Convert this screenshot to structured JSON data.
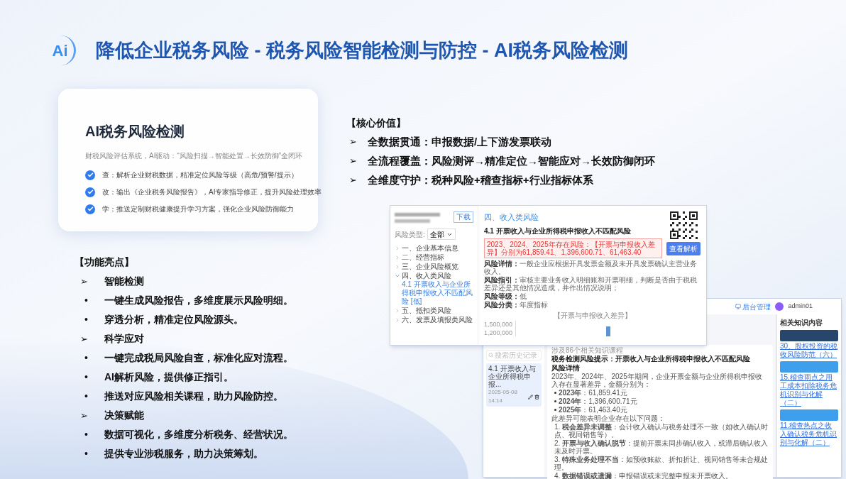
{
  "header": {
    "logo": "Ai",
    "title": "降低企业税务风险 - 税务风险智能检测与防控 - AI税务风险检测"
  },
  "card": {
    "title": "AI税务风险检测",
    "subtitle": "财税风险评估系统，AI驱动：“风险扫描→智能处置→长效防御”全闭环",
    "items": [
      {
        "text": "查：解析企业财税数据，精准定位风险等级（高危/预警/提示）",
        "checked": true
      },
      {
        "text": "改：输出《企业税务风险报告》，AI专家指导修正，提升风险处理效率",
        "checked": true
      },
      {
        "text": "学：推送定制财税健康提升学习方案，强化企业风险防御能力",
        "checked": true
      }
    ]
  },
  "highlights": {
    "heading": "【功能亮点】",
    "groups": [
      {
        "marker": "➢",
        "title": "智能检测",
        "items": [
          {
            "bullet": "•",
            "text": "一键生成风险报告，多维度展示风险明细。"
          },
          {
            "bullet": "•",
            "text": "穿透分析，精准定位风险源头。"
          }
        ]
      },
      {
        "marker": "➢",
        "title": "科学应对",
        "items": [
          {
            "bullet": "•",
            "text": "一键完成税局风险自查，标准化应对流程。"
          },
          {
            "bullet": "•",
            "text": "AI解析风险，提供修正指引。"
          },
          {
            "bullet": "•",
            "text": "推送对应风险相关课程，助力风险防控。"
          }
        ]
      },
      {
        "marker": "➢",
        "title": "决策赋能",
        "items": [
          {
            "bullet": "•",
            "text": "数据可视化，多维度分析税务、经营状况。"
          },
          {
            "bullet": "•",
            "text": "提供专业涉税服务，助力决策筹划。"
          }
        ]
      }
    ]
  },
  "core_value": {
    "heading": "【核心价值】",
    "items": [
      {
        "marker": "➢",
        "text": "全数据贯通：申报数据/上下游发票联动"
      },
      {
        "marker": "➢",
        "text": "全流程覆盖：风险测评→精准定位→智能应对→长效防御闭环"
      },
      {
        "marker": "➢",
        "text": "全维度守护：税种风险+稽查指标+行业指标体系"
      }
    ]
  },
  "report_window": {
    "download_button": "下载",
    "filter": {
      "label": "风险类型:",
      "value": "全部"
    },
    "tree": [
      {
        "label": "一、企业基本信息",
        "expanded": false
      },
      {
        "label": "二、经营指标",
        "expanded": false
      },
      {
        "label": "三、企业风险概览",
        "expanded": false
      },
      {
        "label": "四、收入类风险",
        "expanded": true,
        "children": [
          {
            "label": "4.1 开票收入与企业所得税申报收入不匹配风险 [低]",
            "selected": true
          }
        ]
      },
      {
        "label": "五、抵扣类风险",
        "expanded": false
      },
      {
        "label": "六、发票及填报类风险",
        "expanded": false
      }
    ],
    "section_title": "四、收入类风险",
    "risk_title": "4.1 开票收入与企业所得税申报收入不匹配风险",
    "alert": "2023、2024、2025年存在风险：【开票与申报收入差异】分别为61,859.41、1,396,600.71、61,463.40",
    "fields": [
      {
        "label": "风险详情：",
        "value": "一般企业应根据开具发票金额及未开具发票确认主营业务收入。"
      },
      {
        "label": "风险指引：",
        "value": "审核主要业务收入明细账和开票明细，判断是否由于税税差异还是其他情况造成，并作出情况说明；"
      },
      {
        "label": "风险等级：",
        "value": "低"
      },
      {
        "label": "风险分类：",
        "value": "年度指标"
      }
    ],
    "analysis_button": "查看解析",
    "chart": {
      "legend": "【开票与申报收入差异】",
      "ticks": [
        "1,500,000",
        "1,200,000"
      ]
    }
  },
  "chat_window": {
    "admin_link": "后台管理",
    "user": "admin01",
    "history": {
      "search_placeholder": "搜索历史记录",
      "items": [
        {
          "title": "4.1 开票收入与企业所得税申报...",
          "time": "2025-05-08 14:14",
          "selected": true
        }
      ]
    },
    "message": {
      "tag": "涉及86个相关知识课程",
      "title": "税务检测风险提示：开票收入与企业所得税申报收入不匹配风险",
      "section": "风险详情",
      "intro": "2023年、2024年、2025年期间，企业开票金额与企业所得税申报收入存在显著差异，金额分别为：",
      "amounts": [
        "**2023年**：61,859.41元",
        "**2024年**：1,396,600.71元",
        "**2025年**：61,463.40元"
      ],
      "lead": "此差异可能表明企业存在以下问题：",
      "issues": [
        "1. **税会差异未调整**：会计收入确认与税务处理不一致（如收入确认时点、视同销售等）。",
        "2. **开票与收入确认脱节**：提前开票未同步确认收入，或滞后确认收入未及时开票。",
        "3. **特殊业务处理不当**：如预收账款、折扣折让、视同销售等未合规处理。",
        "4. **数据错误或遗漏**：申报错误或未完整申报未开票收入。"
      ]
    },
    "related": {
      "heading": "相关知识内容",
      "items": [
        {
          "title": "30、股权投资的税收风险防范（六）"
        },
        {
          "title": "15.稽查雨点之用工成本扣除税务危机识别与化解（二）"
        },
        {
          "title": "11.稽查热点之收入确认税务危机识别与化解（二）"
        }
      ]
    }
  }
}
